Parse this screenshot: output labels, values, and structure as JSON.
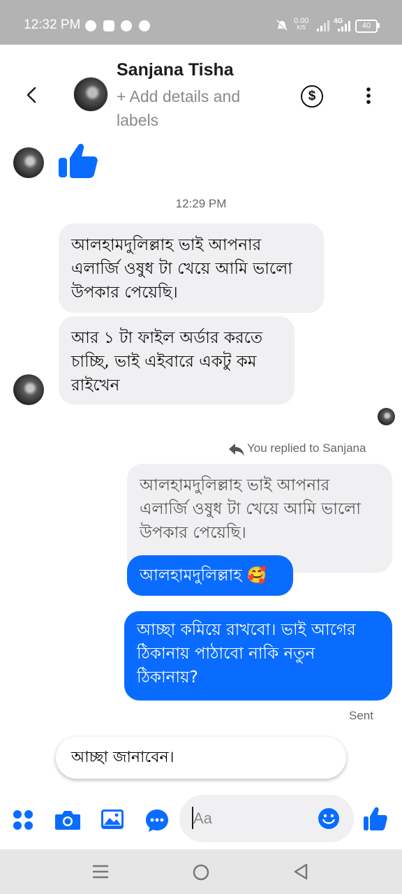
{
  "status_bar": {
    "time": "12:32 PM",
    "net_speed_top": "0.00",
    "net_speed_bottom": "K/S",
    "network": "4G",
    "battery": "40"
  },
  "header": {
    "contact_name": "Sanjana Tisha",
    "add_details": "+ Add details and labels",
    "pay_symbol": "$"
  },
  "conversation": {
    "timestamp": "12:29 PM",
    "incoming_1": "আলহামদুলিল্লাহ ভাই আপনার এলার্জি ওষুধ টা খেয়ে আমি ভালো উপকার পেয়েছি।",
    "incoming_2": "আর ১ টা ফাইল অর্ডার করতে চাচ্ছি, ভাই এইবারে একটু কম রাইখেন",
    "reply_note": "You replied to Sanjana",
    "quoted_message": "আলহামদুলিল্লাহ ভাই আপনার এলার্জি ওষুধ টা খেয়ে আমি ভালো উপকার পেয়েছি।",
    "outgoing_reply": "আলহামদুলিল্লাহ",
    "outgoing_reply_emoji": "🥰",
    "outgoing_2": "আচ্ছা কমিয়ে রাখবো। ভাই আগের ঠিকানায় পাঠাবো নাকি নতুন ঠিকানায়?",
    "sent_label": "Sent"
  },
  "suggestion": {
    "text": "আচ্ছা জানাবেন।"
  },
  "composer": {
    "placeholder": "Aa"
  },
  "colors": {
    "accent": "#0a6cff",
    "incoming_bubble": "#f0f0f2",
    "status_bar": "#b3b3b3",
    "nav_bar": "#e6e6e6"
  }
}
